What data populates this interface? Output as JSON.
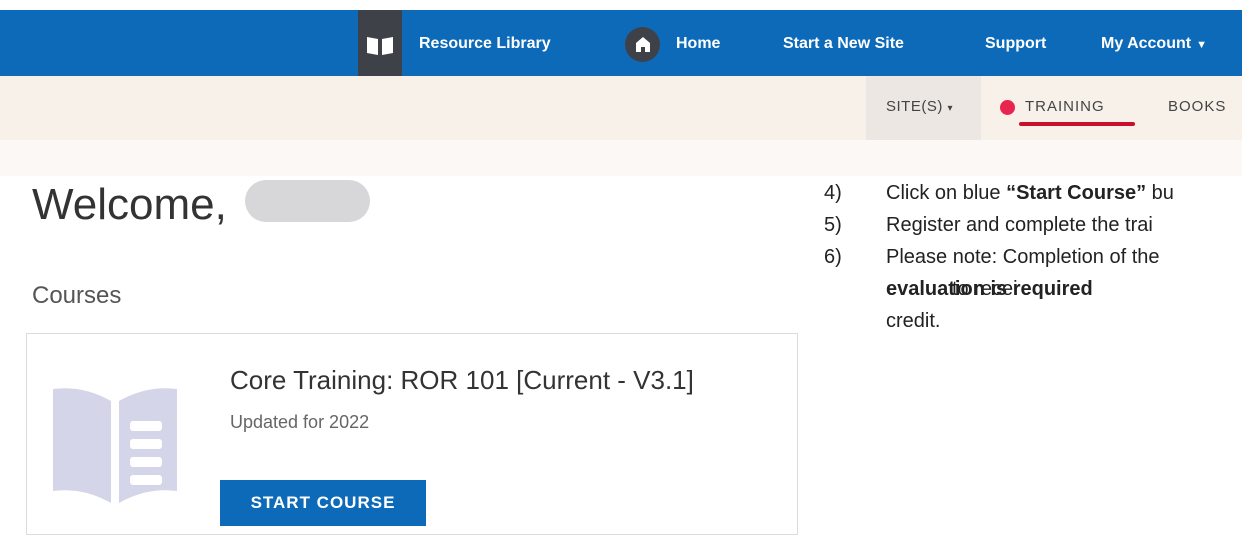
{
  "header": {
    "nav": {
      "resource_library": "Resource Library",
      "home": "Home",
      "start_new_site": "Start a New Site",
      "support": "Support",
      "my_account": "My Account"
    },
    "icons": [
      "book-icon",
      "home-icon",
      "chevron-down-icon"
    ],
    "bar_color": "#0c6ab8"
  },
  "subnav": {
    "sites": "SITE(S)",
    "training": "TRAINING",
    "books": "BOOKS",
    "active_tab": "TRAINING",
    "active_color": "#e8254f"
  },
  "main": {
    "welcome": "Welcome,",
    "courses_heading": "Courses",
    "course": {
      "title": "Core Training: ROR 101 [Current - V3.1]",
      "subtitle": "Updated for 2022",
      "button": "START COURSE"
    }
  },
  "instructions": {
    "steps": [
      {
        "num": "4)",
        "pre": "Click on blue ",
        "bold": "“Start Course”",
        "post": " bu"
      },
      {
        "num": "5)",
        "text": "Register and complete the trai"
      },
      {
        "num": "6)",
        "text": "Please note: Completion of the"
      }
    ],
    "continuation": {
      "bold": "evaluation is required",
      "post": " to recei",
      "line3": "credit."
    }
  }
}
